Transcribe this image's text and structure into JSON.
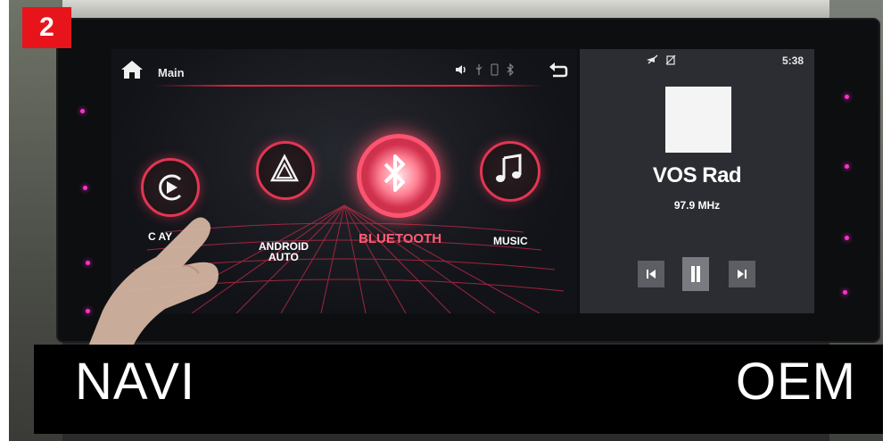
{
  "badge": {
    "number": "2"
  },
  "head_unit": {
    "topbar": {
      "title": "Main",
      "home_icon": "home-icon",
      "status_icons": [
        "speaker-icon",
        "usb-icon",
        "phone-icon",
        "bluetooth-icon"
      ],
      "back_icon": "back-arrow-icon"
    },
    "apps": [
      {
        "label": "CARPLAY",
        "visible_label": "C     AY",
        "icon": "carplay-icon"
      },
      {
        "label_line1": "ANDROID",
        "label_line2": "AUTO",
        "icon": "android-auto-icon"
      },
      {
        "label": "BLUETOOTH",
        "icon": "bluetooth-icon",
        "active": true
      },
      {
        "label": "MUSIC",
        "icon": "music-note-icon"
      }
    ],
    "next_icon": "chevron-right-icon"
  },
  "radio_panel": {
    "status_icons": [
      "mute-icon",
      "no-signal-icon"
    ],
    "time": "5:38",
    "station": "VOS Rad",
    "frequency": "97.9 MHz",
    "controls": [
      "previous-icon",
      "pause-icon",
      "next-icon"
    ]
  },
  "caption": {
    "left": "NAVI",
    "right": "OEM"
  },
  "colors": {
    "badge": "#e8141b",
    "accent": "#e23653",
    "active_label": "#ff5d77",
    "caption_bg": "#000000"
  }
}
